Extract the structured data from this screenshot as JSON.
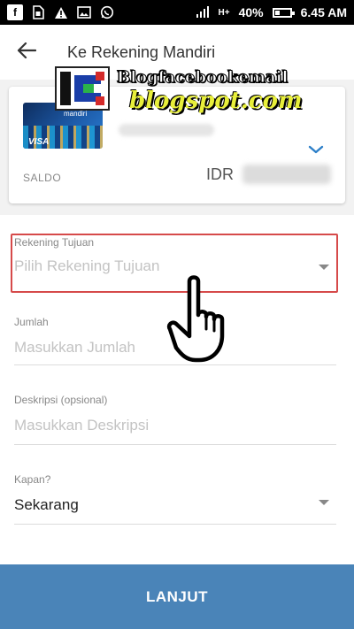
{
  "status_bar": {
    "battery": "40%",
    "network_type": "H+",
    "time": "6.45 AM",
    "battery_level": 0.4,
    "icons": [
      "facebook-icon",
      "sim-card-icon",
      "warning-icon",
      "image-icon",
      "whatsapp-icon",
      "signal-icon"
    ]
  },
  "header": {
    "title": "Ke Rekening Mandiri",
    "back_icon": "arrow-left-icon"
  },
  "watermark": {
    "line1": "Blogfacebookemail",
    "line2": "blogspot.com"
  },
  "account_card": {
    "card_brand": "mandiri",
    "card_network": "VISA",
    "balance_label": "SALDO",
    "currency": "IDR",
    "expand_icon": "chevron-down-icon"
  },
  "form": {
    "destination": {
      "label": "Rekening Tujuan",
      "placeholder": "Pilih Rekening Tujuan"
    },
    "amount": {
      "label": "Jumlah",
      "placeholder": "Masukkan Jumlah"
    },
    "description": {
      "label": "Deskripsi (opsional)",
      "placeholder": "Masukkan Deskripsi"
    },
    "when": {
      "label": "Kapan?",
      "value": "Sekarang"
    }
  },
  "submit_label": "LANJUT",
  "colors": {
    "primary_button": "#4a84b8",
    "highlight_border": "#d64a4a",
    "chevron": "#2c7fc8"
  }
}
